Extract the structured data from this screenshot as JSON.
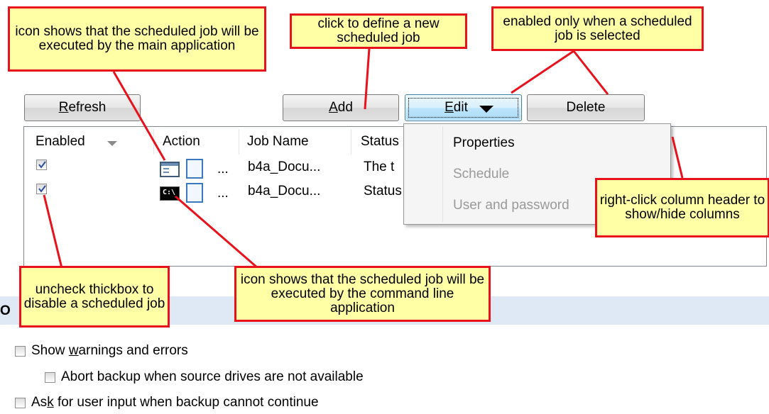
{
  "toolbar": {
    "refresh_label_u": "R",
    "refresh_label_rest": "efresh",
    "add_label_u": "A",
    "add_label_rest": "dd",
    "edit_label_u": "E",
    "edit_label_rest": "dit",
    "delete_label": "Delete"
  },
  "list": {
    "columns": [
      "Enabled",
      "Action",
      "Job Name",
      "Status"
    ],
    "rows": [
      {
        "enabled": true,
        "action_icon": "main-app-window-icon",
        "ellipsis": "...",
        "job_name": "b4a_Docu...",
        "status": "The t"
      },
      {
        "enabled": true,
        "action_icon": "command-line-icon",
        "ellipsis": "...",
        "job_name": "b4a_Docu...",
        "status": "Status"
      }
    ],
    "cmd_icon_text": "C:\\"
  },
  "edit_menu": {
    "items": [
      {
        "label": "Properties",
        "enabled": true
      },
      {
        "label": "Schedule",
        "enabled": false
      },
      {
        "label": "User and password",
        "enabled": false
      }
    ]
  },
  "callouts": {
    "main_app": "icon shows that the scheduled job will be executed by the main application",
    "add": "click to define a new scheduled job",
    "edit": "enabled only when a scheduled job is selected",
    "columns": "right-click column header to show/hide columns",
    "uncheck": "uncheck thickbox to disable a scheduled job",
    "cmd_line": "icon shows that the scheduled job will be executed by the command line application"
  },
  "options": {
    "section_label": "O",
    "show_warnings_pre": "Show ",
    "show_warnings_u": "w",
    "show_warnings_post": "arnings and errors",
    "abort_backup": "Abort backup when source drives are not available",
    "ask_input_pre": "As",
    "ask_input_u": "k",
    "ask_input_post": " for user input when backup cannot continue"
  },
  "colors": {
    "callout_fill": "#ffffa6",
    "callout_border": "#e8121c",
    "section_bar": "#dfe9f5"
  }
}
